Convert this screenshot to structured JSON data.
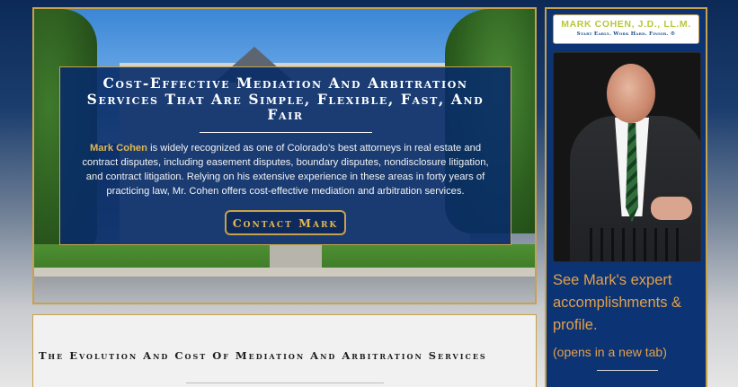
{
  "hero": {
    "title": "Cost-Effective Mediation And Arbitration Services That Are Simple, Flexible, Fast, And Fair",
    "body_name": "Mark Cohen",
    "body_text": " is widely recognized as one of Colorado’s best attorneys in real estate and contract disputes, including easement disputes, boundary disputes, nondisclosure litigation, and contract litigation. Relying on his extensive experience in these areas in forty years of practicing law, Mr. Cohen offers cost-effective mediation and arbitration services.",
    "cta_label": "Contact Mark"
  },
  "article": {
    "heading": "The Evolution And Cost Of Mediation And Arbitration Services"
  },
  "sidebar": {
    "logo_name": "MARK COHEN, J.D., LL.M.",
    "logo_tagline": "Start Early. Work Hard. Finish. ®",
    "link_text": "See Mark's expert accomplishments & profile.",
    "link_note": "(opens in a new tab)"
  },
  "colors": {
    "accent_gold": "#c8a24a",
    "link_orange": "#e3a04a",
    "panel_navy": "#0c3474"
  }
}
